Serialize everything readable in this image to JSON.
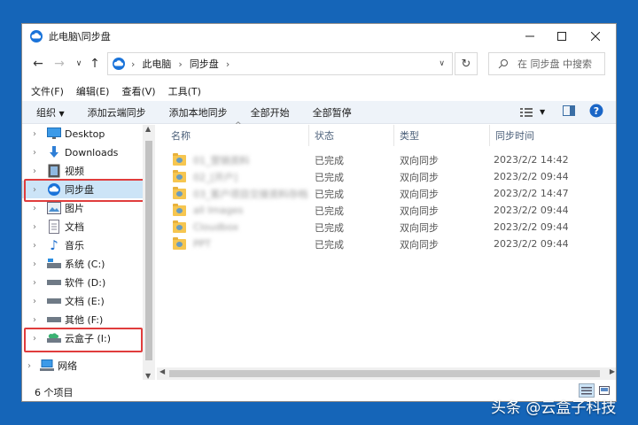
{
  "window": {
    "title": "此电脑\\同步盘"
  },
  "address": {
    "parts": [
      "此电脑",
      "同步盘"
    ]
  },
  "search": {
    "placeholder": "在 同步盘 中搜索"
  },
  "menu": [
    "文件(F)",
    "编辑(E)",
    "查看(V)",
    "工具(T)"
  ],
  "toolbar": {
    "organize": "组织",
    "add_cloud_sync": "添加云端同步",
    "add_local_sync": "添加本地同步",
    "start_all": "全部开始",
    "pause_all": "全部暂停"
  },
  "nav": [
    {
      "label": "Desktop",
      "icon": "desktop-icon"
    },
    {
      "label": "Downloads",
      "icon": "download-arrow-icon"
    },
    {
      "label": "视频",
      "icon": "video-icon"
    },
    {
      "label": "同步盘",
      "icon": "cloud-sync-icon",
      "selected": true
    },
    {
      "label": "图片",
      "icon": "picture-icon"
    },
    {
      "label": "文档",
      "icon": "document-icon"
    },
    {
      "label": "音乐",
      "icon": "music-note-icon"
    },
    {
      "label": "系统 (C:)",
      "icon": "system-drive-icon"
    },
    {
      "label": "软件 (D:)",
      "icon": "drive-icon"
    },
    {
      "label": "文档 (E:)",
      "icon": "drive-icon"
    },
    {
      "label": "其他 (F:)",
      "icon": "drive-icon"
    },
    {
      "label": "云盒子 (I:)",
      "icon": "cloud-drive-icon"
    },
    {
      "label": "网络",
      "icon": "network-icon"
    }
  ],
  "columns": {
    "name": "名称",
    "status": "状态",
    "type": "类型",
    "time": "同步时间"
  },
  "files": [
    {
      "name": "01_营销资料",
      "status": "已完成",
      "type": "双向同步",
      "time": "2023/2/2 14:42"
    },
    {
      "name": "02_[开户]",
      "status": "已完成",
      "type": "双向同步",
      "time": "2023/2/2 09:44"
    },
    {
      "name": "03_客户项目交接资料存档",
      "status": "已完成",
      "type": "双向同步",
      "time": "2023/2/2 14:47"
    },
    {
      "name": "all Images",
      "status": "已完成",
      "type": "双向同步",
      "time": "2023/2/2 09:44"
    },
    {
      "name": "Cloudbox",
      "status": "已完成",
      "type": "双向同步",
      "time": "2023/2/2 09:44"
    },
    {
      "name": "PPT",
      "status": "已完成",
      "type": "双向同步",
      "time": "2023/2/2 09:44"
    }
  ],
  "status": {
    "item_count": "6 个项目"
  },
  "watermark": "头条 @云盒子科技",
  "colors": {
    "accent": "#1565b8",
    "selection": "#cce4f7",
    "highlight": "#e03c3c",
    "folder": "#f6c650"
  }
}
